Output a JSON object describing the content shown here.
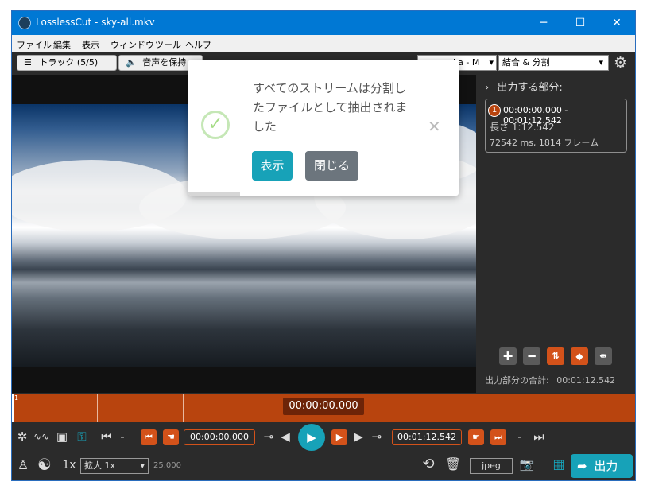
{
  "window": {
    "title": "LosslessCut - sky-all.mkv",
    "minimize": "─",
    "maximize": "☐",
    "close": "✕"
  },
  "menu": [
    "ファイル",
    "編集",
    "表示",
    "ウィンドウ",
    "ツール",
    "ヘルプ"
  ],
  "toolbar": {
    "tracks_label": "トラック (5/5)",
    "audio_label": "音声を保持",
    "format_select": "ka - M",
    "mode_select": "結合 & 分割"
  },
  "notification": {
    "message": "すべてのストリームは分割したファイルとして抽出されました",
    "show_button": "表示",
    "close_button": "閉じる",
    "dismiss_glyph": "✕",
    "check_glyph": "✓"
  },
  "segments_panel": {
    "header": "出力する部分:",
    "segment": {
      "number": "1",
      "range": "00:00:00.000 - 00:01:12.542",
      "duration": "長さ 1:12.542",
      "frames": "72542 ms, 1814 フレーム"
    },
    "total_label": "出力部分の合計:",
    "total_value": "00:01:12.542"
  },
  "timeline": {
    "segment_number": "1",
    "current_time": "00:00:00.000"
  },
  "controls": {
    "minus": "-",
    "start_time": "00:00:00.000",
    "end_time": "00:01:12.542",
    "speed": "1x",
    "zoom_select": "拡大 1x",
    "fps": "25.000",
    "capture_format": "jpeg",
    "export_label": "出力"
  },
  "colors": {
    "accent_orange": "#d3521a",
    "timeline_orange": "#b8440e",
    "teal": "#17a2b8",
    "gray_button": "#6c757d",
    "title_blue": "#0078d4"
  }
}
